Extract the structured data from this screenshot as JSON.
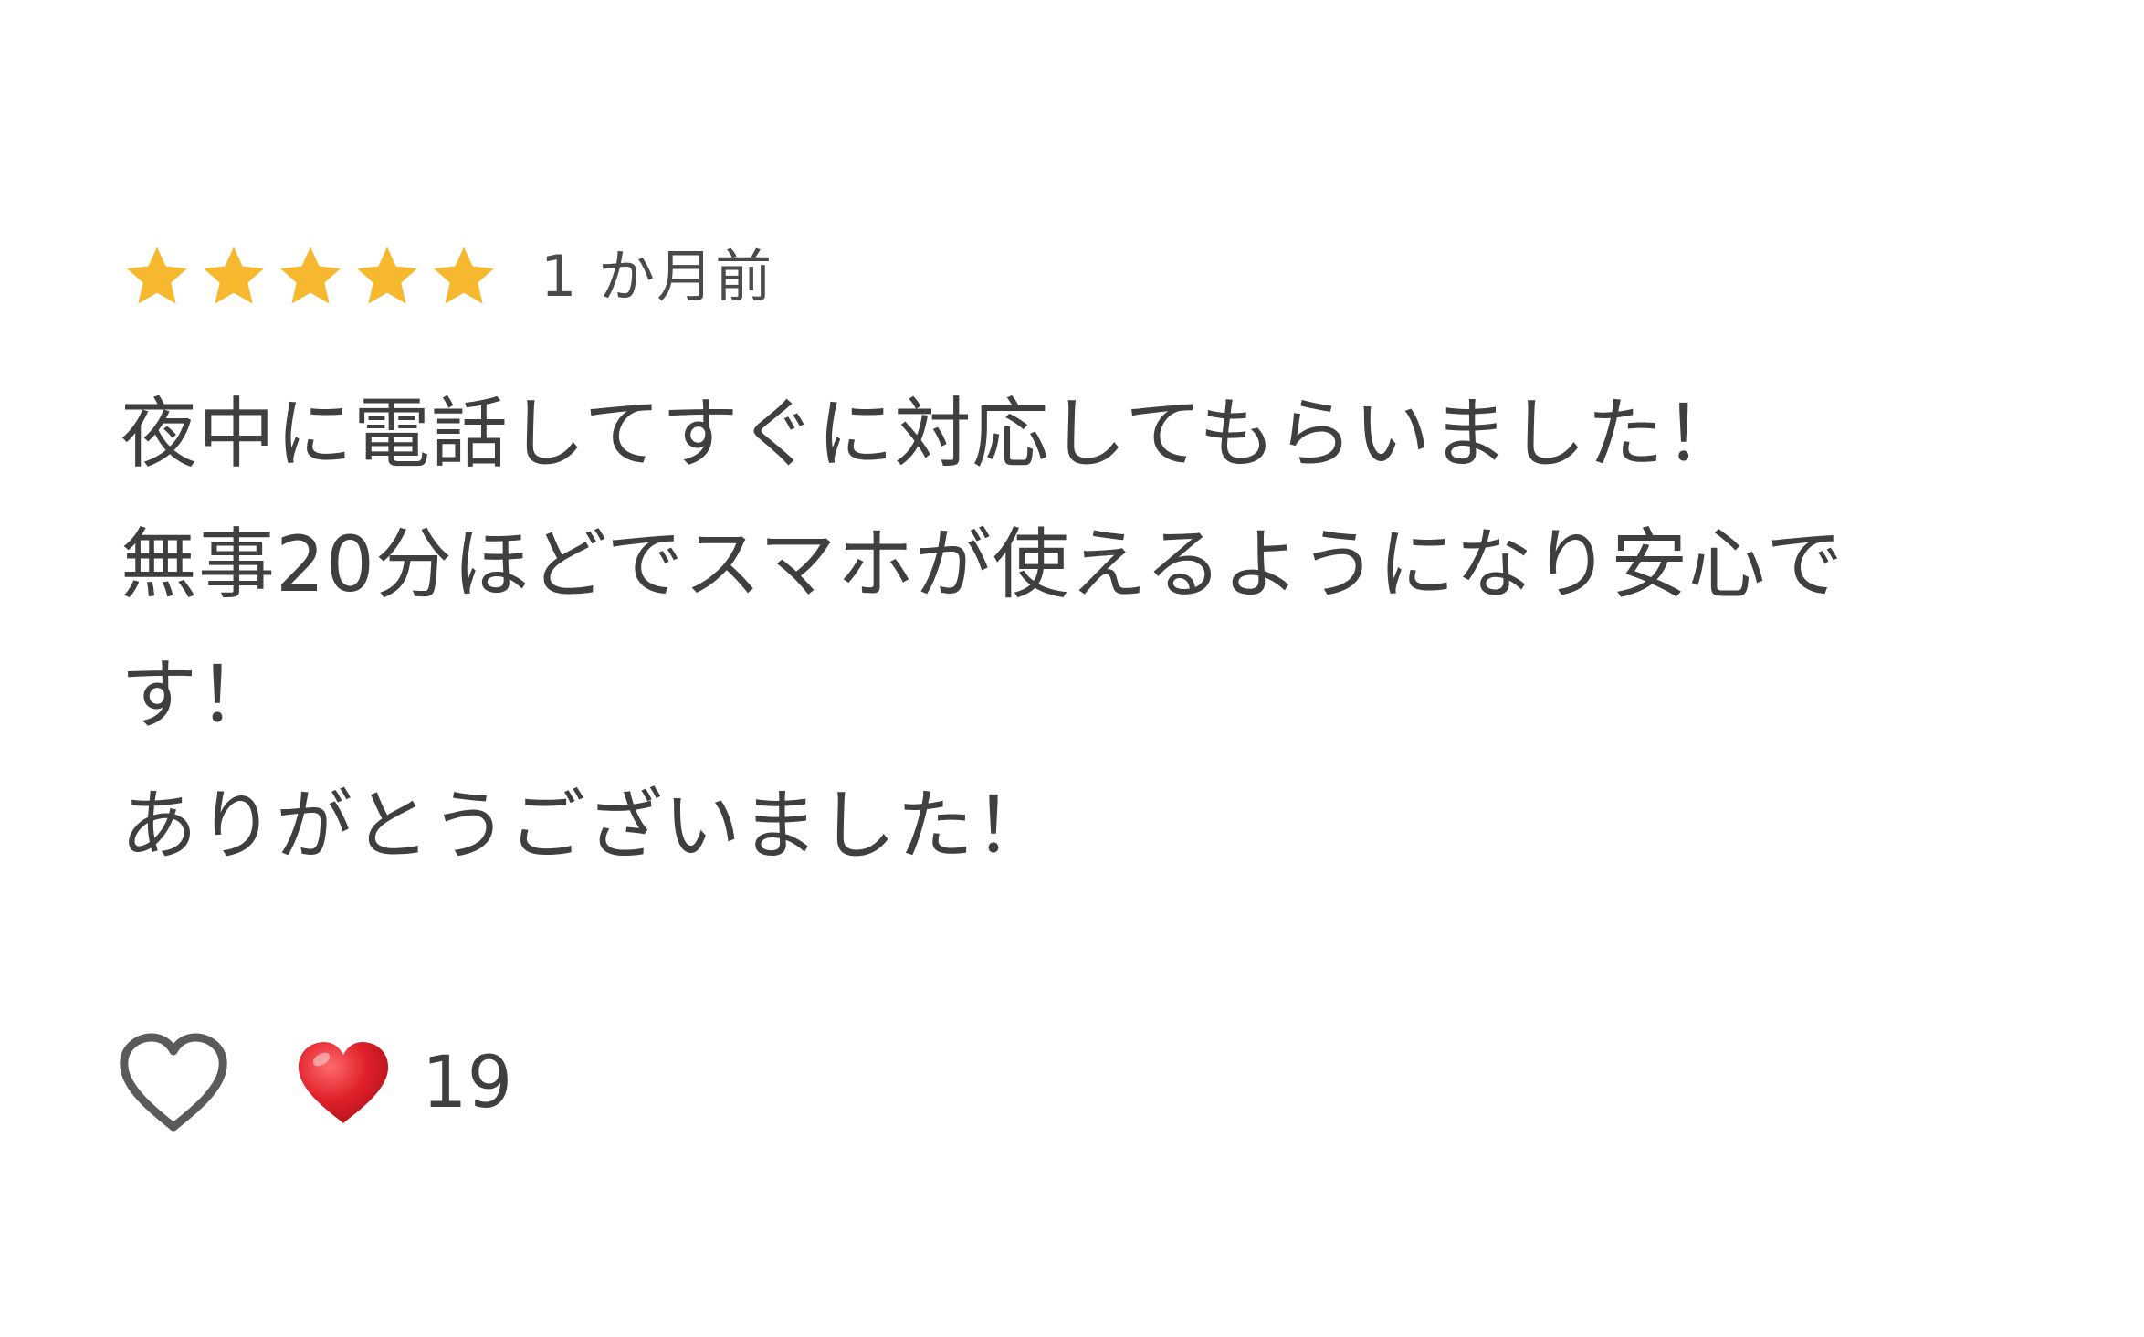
{
  "review": {
    "rating": 5,
    "max_rating": 5,
    "star_color": "#F5B82E",
    "time_ago": "1 か月前",
    "body_lines": [
      "夜中に電話してすぐに対応してもらいました！",
      "無事20分ほどでスマホが使えるようになり安心で",
      "す！",
      "ありがとうございました！"
    ]
  },
  "actions": {
    "like_icon": "heart-outline-icon",
    "reaction_icon": "heart-filled-icon",
    "reaction_color": "#E0202A",
    "reaction_count": "19"
  }
}
